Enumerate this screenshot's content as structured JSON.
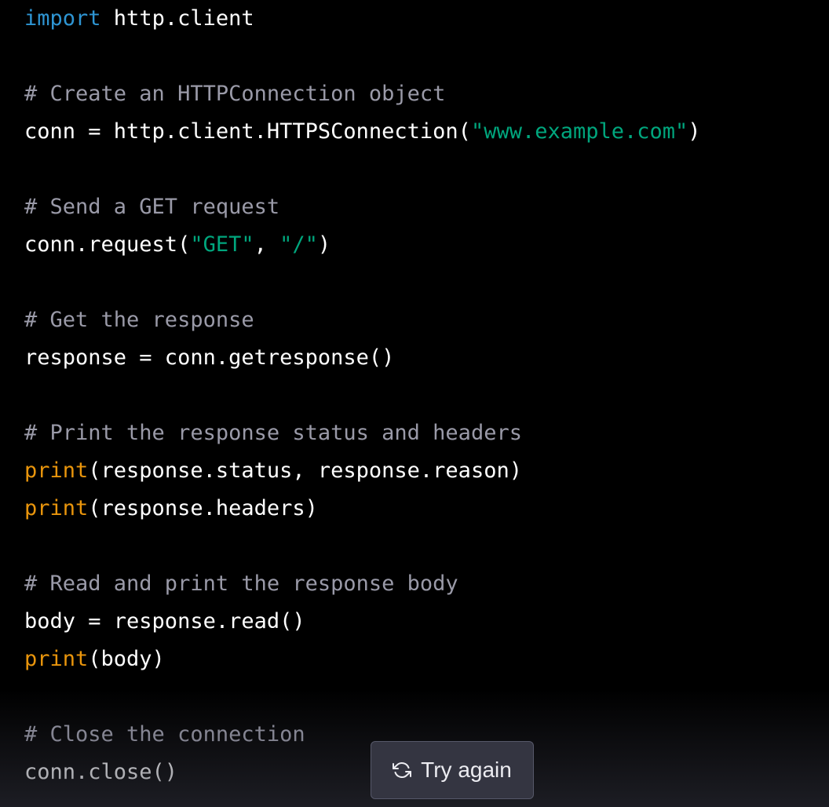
{
  "code_block": {
    "language": "python",
    "colors": {
      "keyword": "#2e95d3",
      "string": "#00a67d",
      "builtin": "#e9950c",
      "comment": "#9a9aa8",
      "plain": "#ffffff"
    },
    "lines": [
      [
        {
          "t": "import",
          "k": "keyword"
        },
        {
          "t": " http.client",
          "k": "plain"
        }
      ],
      [],
      [
        {
          "t": "# Create an HTTPConnection object",
          "k": "comment"
        }
      ],
      [
        {
          "t": "conn = http.client.HTTPSConnection(",
          "k": "plain"
        },
        {
          "t": "\"www.example.com\"",
          "k": "string"
        },
        {
          "t": ")",
          "k": "plain"
        }
      ],
      [],
      [
        {
          "t": "# Send a GET request",
          "k": "comment"
        }
      ],
      [
        {
          "t": "conn.request(",
          "k": "plain"
        },
        {
          "t": "\"GET\"",
          "k": "string"
        },
        {
          "t": ", ",
          "k": "plain"
        },
        {
          "t": "\"/\"",
          "k": "string"
        },
        {
          "t": ")",
          "k": "plain"
        }
      ],
      [],
      [
        {
          "t": "# Get the response",
          "k": "comment"
        }
      ],
      [
        {
          "t": "response = conn.getresponse()",
          "k": "plain"
        }
      ],
      [],
      [
        {
          "t": "# Print the response status and headers",
          "k": "comment"
        }
      ],
      [
        {
          "t": "print",
          "k": "builtin"
        },
        {
          "t": "(response.status, response.reason)",
          "k": "plain"
        }
      ],
      [
        {
          "t": "print",
          "k": "builtin"
        },
        {
          "t": "(response.headers)",
          "k": "plain"
        }
      ],
      [],
      [
        {
          "t": "# Read and print the response body",
          "k": "comment"
        }
      ],
      [
        {
          "t": "body = response.read()",
          "k": "plain"
        }
      ],
      [
        {
          "t": "print",
          "k": "builtin"
        },
        {
          "t": "(body)",
          "k": "plain"
        }
      ],
      [],
      [
        {
          "t": "# Close the connection",
          "k": "comment"
        }
      ],
      [
        {
          "t": "conn.close()",
          "k": "plain"
        }
      ]
    ]
  },
  "try_again_button": {
    "label": "Try again",
    "icon": "refresh-icon"
  }
}
